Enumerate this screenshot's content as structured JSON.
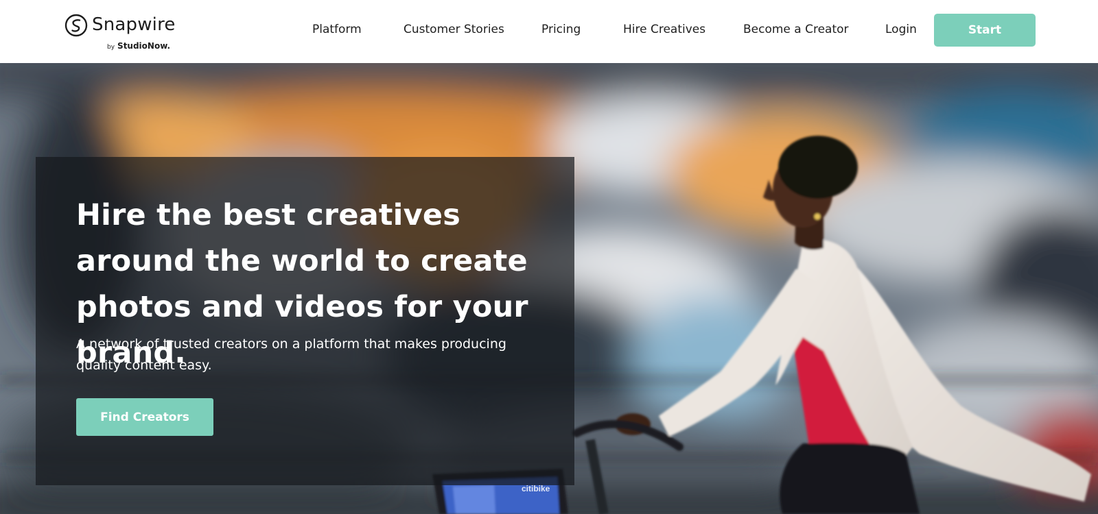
{
  "brand": {
    "name": "Snapwire",
    "by_word": "by",
    "by_brand": "StudioNow.",
    "accent_color": "#7ccfba"
  },
  "nav": {
    "items": [
      {
        "label": "Platform"
      },
      {
        "label": "Customer Stories"
      },
      {
        "label": "Pricing"
      },
      {
        "label": "Hire Creatives"
      },
      {
        "label": "Become a Creator"
      },
      {
        "label": "Login"
      }
    ],
    "cta_label": "Start"
  },
  "hero": {
    "headline": "Hire the best creatives around the world to create photos and videos for your brand.",
    "subheadline": "A network of trusted creators on a platform that makes producing quality content easy.",
    "cta_label": "Find Creators",
    "bike_brand": "citibike"
  },
  "icons": {
    "logo": "snapwire-s-logo-icon"
  }
}
